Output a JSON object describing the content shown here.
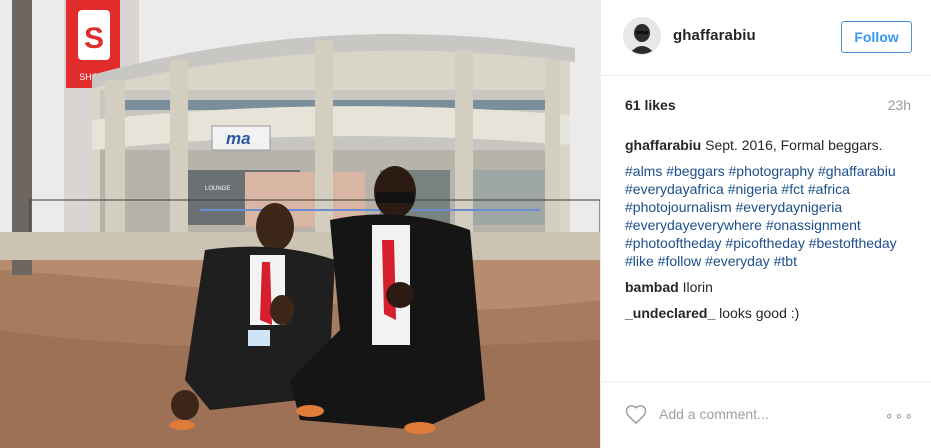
{
  "post": {
    "username": "ghaffarabiu",
    "follow_label": "Follow",
    "likes": "61 likes",
    "age": "23h",
    "caption_user": "ghaffarabiu",
    "caption_text": "Sept. 2016, Formal beggars.",
    "hashtags": "#alms #beggars #photography #ghaffarabiu #everydayafrica #nigeria #fct #africa #photojournalism #everydaynigeria #everydayeverywhere #onassignment #photooftheday #picoftheday #bestoftheday #like #follow #everyday #tbt",
    "comments": [
      {
        "user": "bambad",
        "text": "Ilorin"
      },
      {
        "user": "_undeclared_",
        "text": "looks good :)"
      }
    ],
    "add_comment_placeholder": "Add a comment...",
    "more_label": "∘∘∘"
  },
  "photo": {
    "store_sign_left": "S",
    "store_sign_text": "SHOP",
    "building_sign": "ma",
    "lounge_sign": "LOUNGE"
  },
  "icons": {
    "heart": "heart-icon",
    "more": "more-options-icon",
    "avatar": "avatar"
  }
}
